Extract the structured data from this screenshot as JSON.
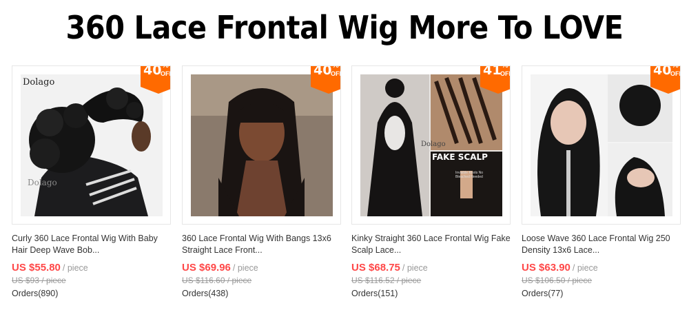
{
  "banner": {
    "title": "360 Lace Frontal Wig More To LOVE"
  },
  "colors": {
    "accent": "#ff6a00",
    "price": "#ff4747"
  },
  "products": [
    {
      "title": "Curly 360 Lace Frontal Wig With Baby Hair Deep Wave Bob...",
      "discount_num": "40",
      "discount_pct": "%",
      "discount_off": "OFF",
      "price": "US $55.80",
      "unit": "/ piece",
      "old_price": "US $93 / piece",
      "orders": "Orders(890)",
      "brand": "Dolago",
      "watermark": "Dolago",
      "image_icon": "curly-wig-photo"
    },
    {
      "title": "360 Lace Frontal Wig With Bangs 13x6 Straight Lace Front...",
      "discount_num": "40",
      "discount_pct": "%",
      "discount_off": "OFF",
      "price": "US $69.96",
      "unit": "/ piece",
      "old_price": "US $116.60 / piece",
      "orders": "Orders(438)",
      "image_icon": "straight-bangs-wig-photo"
    },
    {
      "title": "Kinky Straight 360 Lace Frontal Wig Fake Scalp Lace...",
      "discount_num": "41",
      "discount_pct": "%",
      "discount_off": "OFF",
      "price": "US $68.75",
      "unit": "/ piece",
      "old_price": "US $116.52 / piece",
      "orders": "Orders(151)",
      "watermark": "Dolago",
      "image_text": "FAKE SCALP",
      "image_subtext": "Invisible Knots No Bleached Needed",
      "image_icon": "kinky-straight-wig-photo"
    },
    {
      "title": "Loose Wave 360 Lace Frontal Wig 250 Density 13x6 Lace...",
      "discount_num": "40",
      "discount_pct": "%",
      "discount_off": "OFF",
      "price": "US $63.90",
      "unit": "/ piece",
      "old_price": "US $106.50 / piece",
      "orders": "Orders(77)",
      "image_icon": "loose-wave-wig-photo"
    }
  ]
}
